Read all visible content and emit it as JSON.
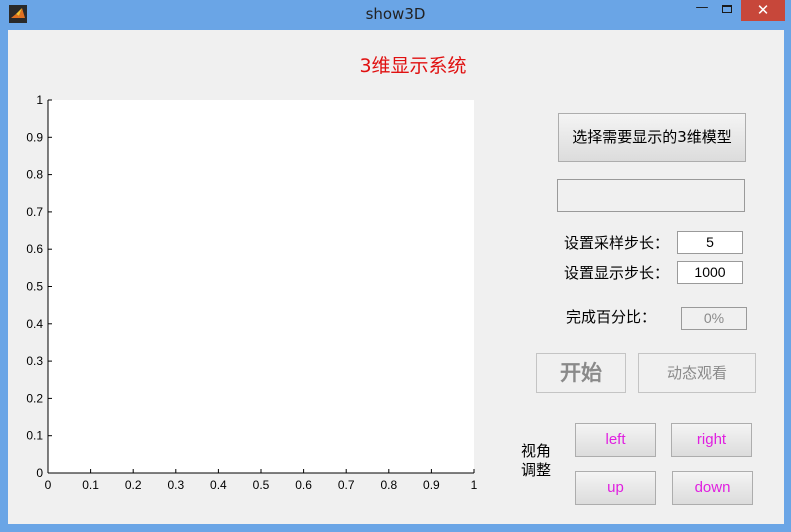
{
  "window": {
    "title": "show3D",
    "minimize_glyph": "—",
    "close_glyph": "✕"
  },
  "app": {
    "heading": "3维显示系统"
  },
  "controls": {
    "select_model_label": "选择需要显示的3维模型",
    "model_path_value": "",
    "sample_step_label": "设置采样步长：",
    "sample_step_value": "5",
    "display_step_label": "设置显示步长：",
    "display_step_value": "1000",
    "progress_label": "完成百分比：",
    "progress_value": "0%",
    "start_label": "开始",
    "dynamic_view_label": "动态观看",
    "view_adjust_line1": "视角",
    "view_adjust_line2": "调整",
    "left_label": "left",
    "right_label": "right",
    "up_label": "up",
    "down_label": "down"
  },
  "colors": {
    "window_frame": "#6aa5e6",
    "close_button": "#c7473a",
    "heading": "#e01010",
    "direction_text": "#e020e0",
    "disabled_text": "#8a8a8a"
  },
  "icons": {
    "app_icon": "matlab-membrane-icon"
  },
  "chart_data": {
    "type": "line",
    "title": "",
    "xlabel": "",
    "ylabel": "",
    "xlim": [
      0,
      1
    ],
    "ylim": [
      0,
      1
    ],
    "x_ticks": [
      "0",
      "0.1",
      "0.2",
      "0.3",
      "0.4",
      "0.5",
      "0.6",
      "0.7",
      "0.8",
      "0.9",
      "1"
    ],
    "y_ticks": [
      "0",
      "0.1",
      "0.2",
      "0.3",
      "0.4",
      "0.5",
      "0.6",
      "0.7",
      "0.8",
      "0.9",
      "1"
    ],
    "series": [],
    "grid": false
  }
}
